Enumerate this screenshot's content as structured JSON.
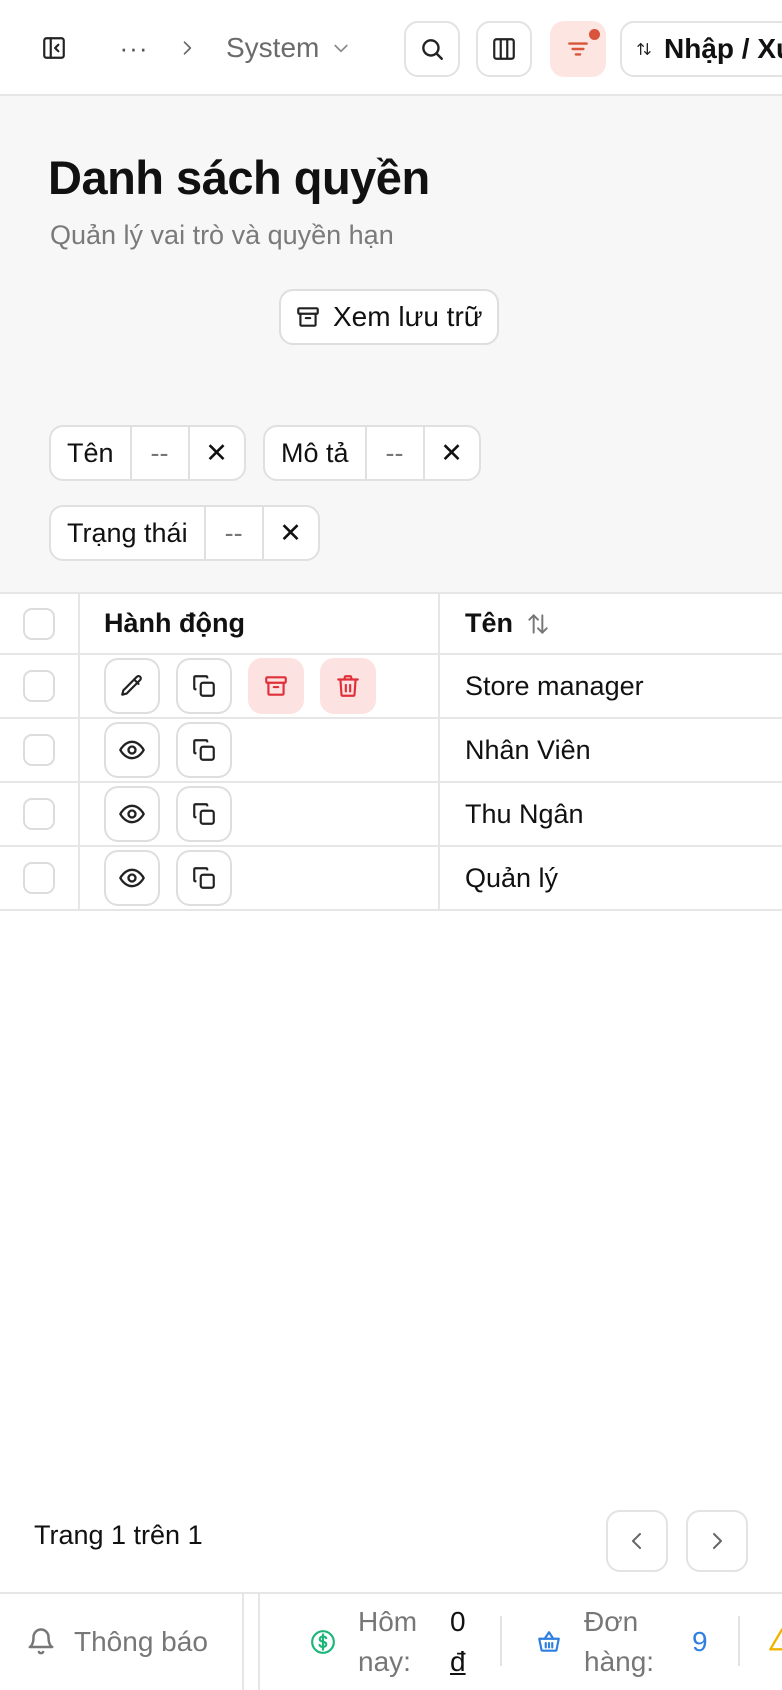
{
  "topbar": {
    "ellipsis": "···",
    "breadcrumb_current": "System",
    "import_label": "Nhập / Xuất"
  },
  "header": {
    "title": "Danh sách quyền",
    "subtitle": "Quản lý vai trò và quyền hạn",
    "archive_label": "Xem lưu trữ"
  },
  "filters": [
    {
      "label": "Tên",
      "value": "--",
      "clear": "✕"
    },
    {
      "label": "Mô tả",
      "value": "--",
      "clear": "✕"
    },
    {
      "label": "Trạng thái",
      "value": "--",
      "clear": "✕"
    }
  ],
  "table": {
    "columns": {
      "actions": "Hành động",
      "name": "Tên"
    },
    "rows": [
      {
        "name": "Store manager",
        "actions": [
          "edit",
          "copy",
          "archive",
          "delete"
        ]
      },
      {
        "name": "Nhân Viên",
        "actions": [
          "view",
          "copy"
        ]
      },
      {
        "name": "Thu Ngân",
        "actions": [
          "view",
          "copy"
        ]
      },
      {
        "name": "Quản lý",
        "actions": [
          "view",
          "copy"
        ]
      }
    ]
  },
  "pagination": {
    "info": "Trang 1 trên 1"
  },
  "statusbar": {
    "notifications": "Thông báo",
    "today_label_1": "Hôm",
    "today_label_2": "nay:",
    "today_value_1": "0",
    "today_value_2": "đ",
    "orders_label_1": "Đơn",
    "orders_label_2": "hàng:",
    "orders_value": "9"
  },
  "colors": {
    "accent": "#d9543a",
    "danger": "#e0303a",
    "danger_bg": "#fde2e2",
    "money_green": "#1fb57a",
    "orders_blue": "#2f7fe0",
    "warning": "#f0b400"
  }
}
